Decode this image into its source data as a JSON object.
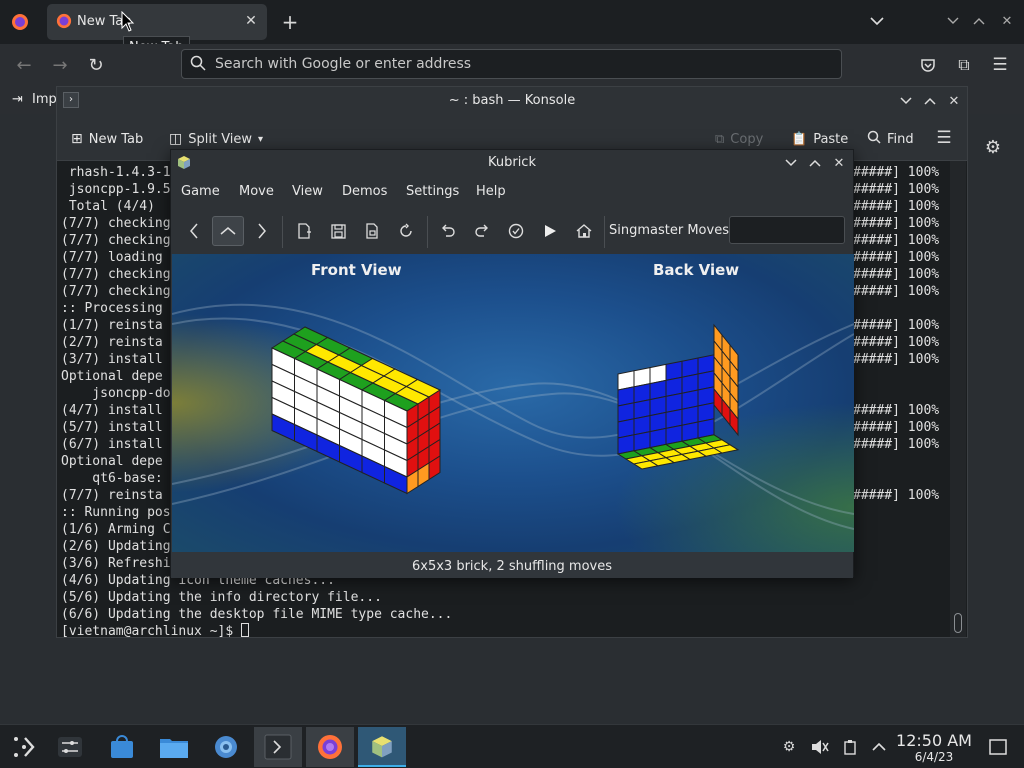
{
  "firefox": {
    "tab_title": "New Tab",
    "tooltip": "New Tab",
    "url_placeholder": "Search with Google or enter address",
    "bookmark_import": "Imp"
  },
  "konsole": {
    "title": "~ : bash — Konsole",
    "toolbar": {
      "new_tab": "New Tab",
      "split_view": "Split View",
      "copy": "Copy",
      "paste": "Paste",
      "find": "Find"
    },
    "terminal_lines": [
      " rhash-1.4.3-1",
      " jsoncpp-1.9.5",
      " Total (4/4)",
      "(7/7) checking",
      "(7/7) checking",
      "(7/7) loading",
      "(7/7) checking",
      "(7/7) checking",
      ":: Processing",
      "(1/7) reinsta",
      "(2/7) reinsta",
      "(3/7) install",
      "Optional depe",
      "    jsoncpp-do",
      "(4/7) install",
      "(5/7) install",
      "(6/7) install",
      "Optional depe",
      "    qt6-base:",
      "(7/7) reinsta",
      ":: Running pos",
      "(1/6) Arming C",
      "(2/6) Updating",
      "(3/6) Refreshi",
      "(4/6) Updating icon theme caches...",
      "(5/6) Updating the info directory file...",
      "(6/6) Updating the desktop file MIME type cache...",
      "[vietnam@archlinux ~]$ "
    ],
    "terminal_right": [
      "#####] 100%",
      "#####] 100%",
      "#####] 100%",
      "#####] 100%",
      "#####] 100%",
      "#####] 100%",
      "#####] 100%",
      "#####] 100%",
      "",
      "#####] 100%",
      "#####] 100%",
      "#####] 100%",
      "",
      "",
      "#####] 100%",
      "#####] 100%",
      "#####] 100%",
      "",
      "",
      "#####] 100%"
    ]
  },
  "kubrick": {
    "title": "Kubrick",
    "menu": [
      "Game",
      "Move",
      "View",
      "Demos",
      "Settings",
      "Help"
    ],
    "singmaster_label": "Singmaster Moves",
    "singmaster_value": "",
    "front_view_label": "Front View",
    "back_view_label": "Back View",
    "status": "6x5x3 brick, 2 shuffling moves",
    "colors": {
      "white": "#ffffff",
      "green": "#1ea01e",
      "yellow": "#ffe800",
      "red": "#e01010",
      "blue": "#1024e0",
      "orange": "#ff9a20"
    }
  },
  "taskbar": {
    "time": "12:50 AM",
    "date": "6/4/23"
  }
}
